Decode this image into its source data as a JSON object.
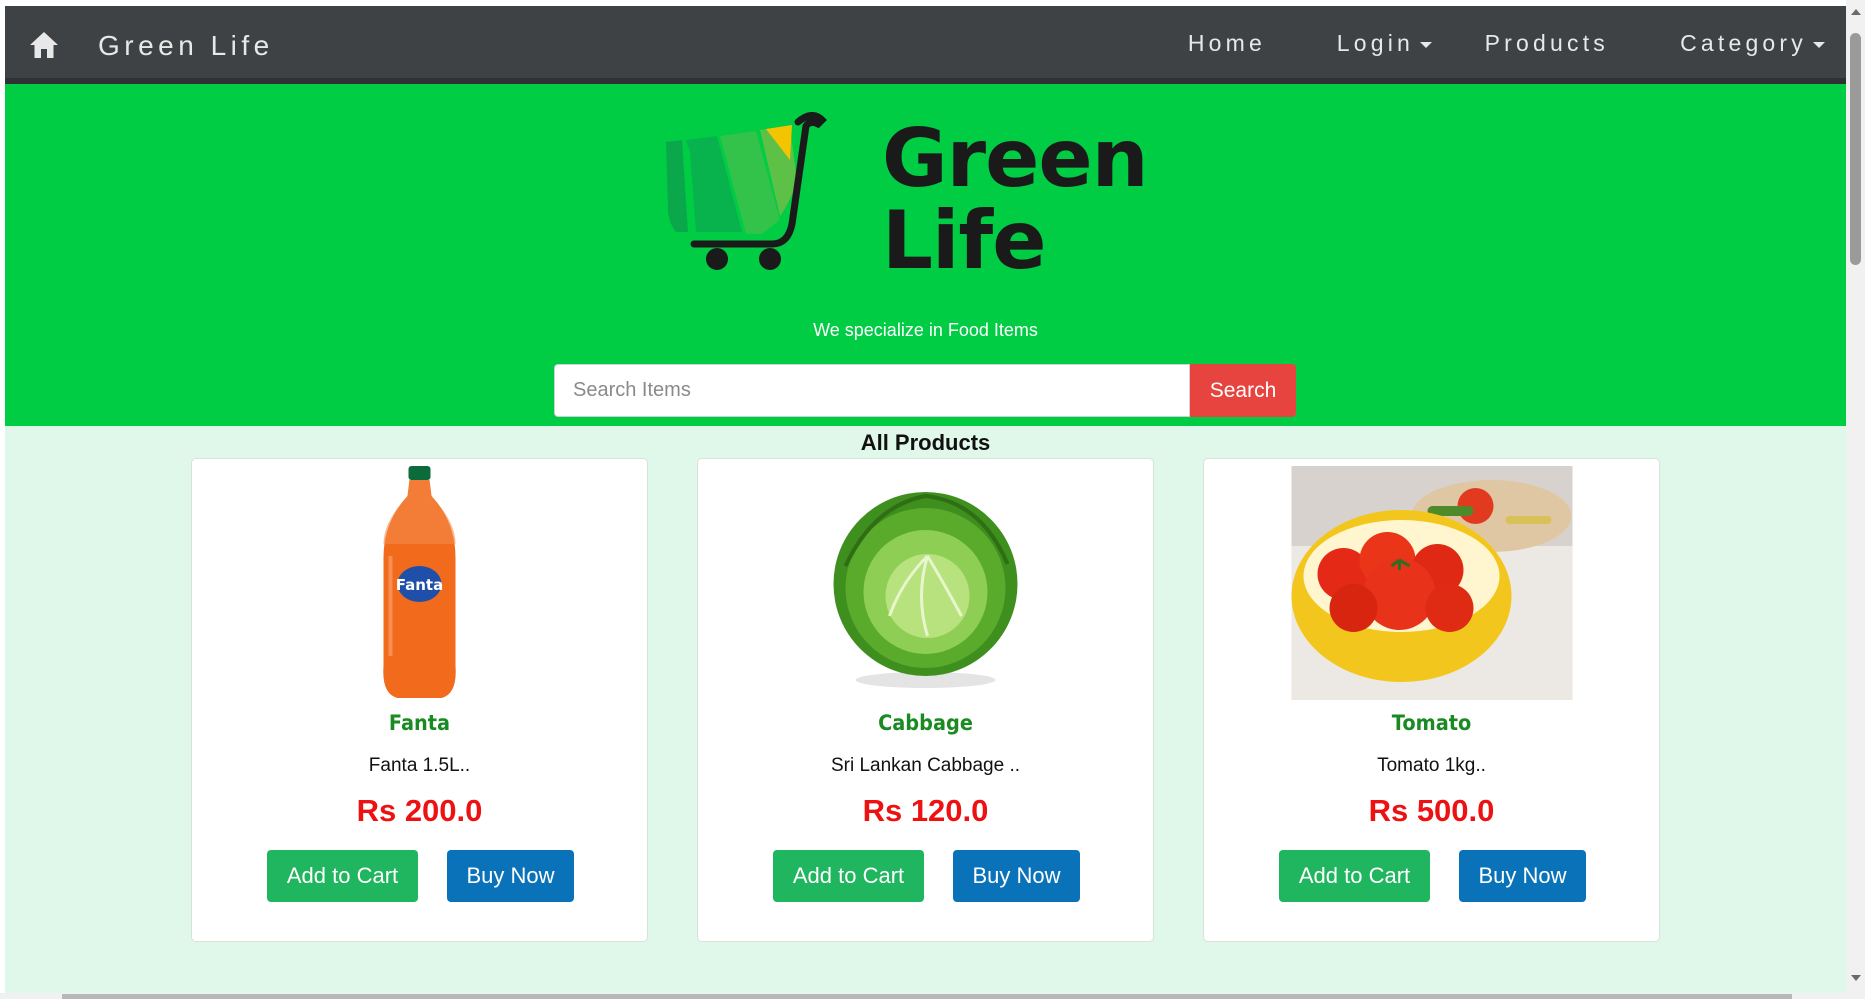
{
  "navbar": {
    "brand": "Green Life",
    "items": [
      {
        "label": "Home",
        "has_dropdown": false
      },
      {
        "label": "Login",
        "has_dropdown": true
      },
      {
        "label": "Products",
        "has_dropdown": false
      },
      {
        "label": "Category",
        "has_dropdown": true
      }
    ]
  },
  "hero": {
    "logo_line1": "Green",
    "logo_line2": "Life",
    "tagline": "We specialize in Food Items",
    "search": {
      "placeholder": "Search Items",
      "value": "",
      "button_label": "Search"
    }
  },
  "products": {
    "section_title": "All Products",
    "items": [
      {
        "name": "Fanta",
        "description": "Fanta 1.5L..",
        "price": "Rs 200.0",
        "add_label": "Add to Cart",
        "buy_label": "Buy Now"
      },
      {
        "name": "Cabbage",
        "description": "Sri Lankan Cabbage ..",
        "price": "Rs 120.0",
        "add_label": "Add to Cart",
        "buy_label": "Buy Now"
      },
      {
        "name": "Tomato",
        "description": "Tomato 1kg..",
        "price": "Rs 500.0",
        "add_label": "Add to Cart",
        "buy_label": "Buy Now"
      }
    ]
  },
  "colors": {
    "navbar": "#3f4244",
    "hero": "#00cc44",
    "background": "#e0f8e9",
    "search_button": "#e8443f",
    "price": "#ee1111",
    "product_name": "#1a8a22",
    "add_to_cart": "#20b55f",
    "buy_now": "#0a72b8"
  }
}
